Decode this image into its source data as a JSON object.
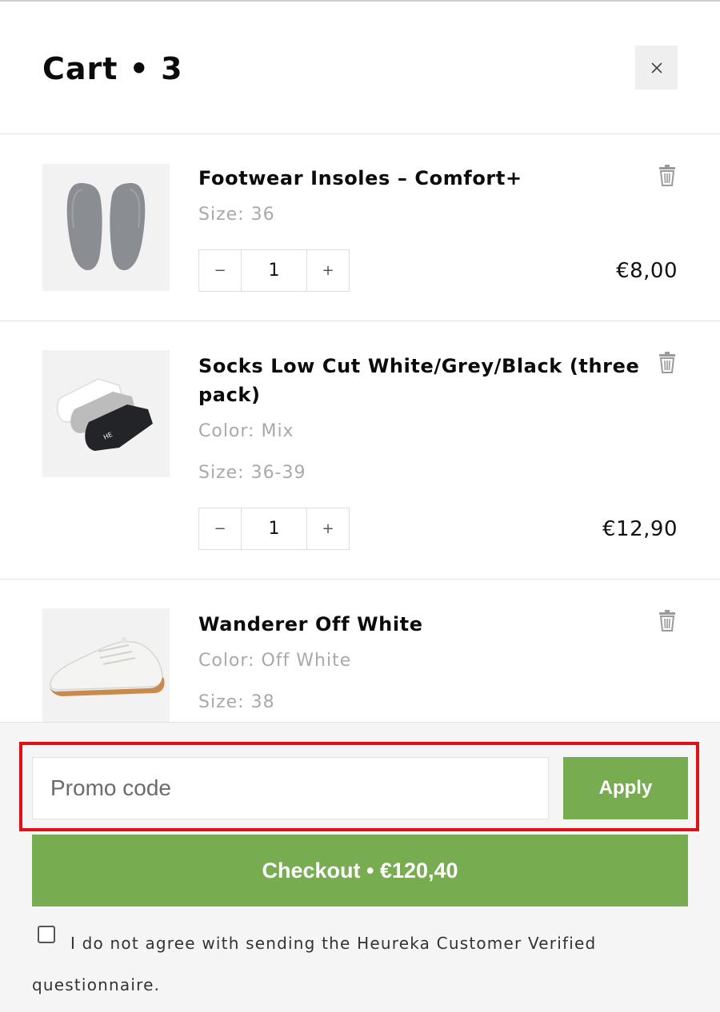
{
  "header": {
    "title": "Cart • 3",
    "close_icon": "×"
  },
  "items": [
    {
      "name": "Footwear Insoles – Comfort+",
      "attributes": [
        "Size: 36"
      ],
      "quantity": "1",
      "minus": "−",
      "plus": "+",
      "price": "€8,00",
      "thumbnail_icon": "insoles-image"
    },
    {
      "name": "Socks Low Cut White/Grey/Black (three pack)",
      "attributes": [
        "Color: Mix",
        "Size: 36-39"
      ],
      "quantity": "1",
      "minus": "−",
      "plus": "+",
      "price": "€12,90",
      "thumbnail_icon": "socks-image"
    },
    {
      "name": "Wanderer Off White",
      "attributes": [
        "Color: Off White",
        "Size: 38"
      ],
      "thumbnail_icon": "sneaker-image"
    }
  ],
  "footer": {
    "promo_placeholder": "Promo code",
    "apply_label": "Apply",
    "checkout_label": "Checkout • €120,40",
    "consent_text": "I do not agree with sending the Heureka Customer Verified questionnaire."
  },
  "colors": {
    "accent_green": "#77ac50",
    "highlight_red": "#e10f16"
  }
}
